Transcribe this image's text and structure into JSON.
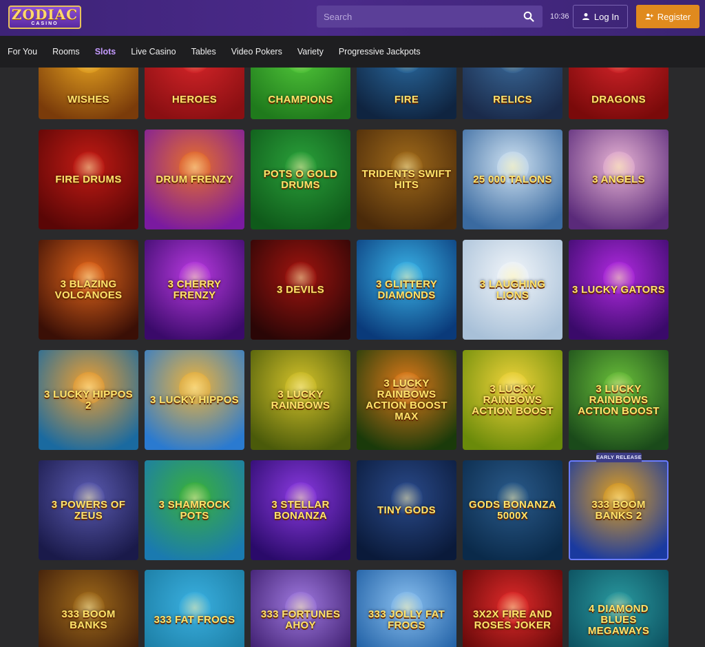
{
  "header": {
    "logo_text": "ZODIAC",
    "logo_sub": "CASINO",
    "search_placeholder": "Search",
    "time": "10:36",
    "login_label": "Log In",
    "register_label": "Register"
  },
  "nav": {
    "items": [
      {
        "label": "For You"
      },
      {
        "label": "Rooms"
      },
      {
        "label": "Slots",
        "active": true
      },
      {
        "label": "Live Casino"
      },
      {
        "label": "Tables"
      },
      {
        "label": "Video Pokers"
      },
      {
        "label": "Variety"
      },
      {
        "label": "Progressive Jackpots"
      }
    ]
  },
  "badge": "EARLY RELEASE",
  "games": [
    [
      {
        "title": "WISHES",
        "colors": [
          "#7a3b0a",
          "#e8a520"
        ]
      },
      {
        "title": "HEROES",
        "colors": [
          "#8a0f12",
          "#d8262a"
        ]
      },
      {
        "title": "CHAMPIONS",
        "colors": [
          "#1f7a1c",
          "#52c83a"
        ]
      },
      {
        "title": "FIRE",
        "colors": [
          "#0f2440",
          "#2a6aa0"
        ]
      },
      {
        "title": "Relics",
        "colors": [
          "#1a2a4a",
          "#3a6a9a"
        ]
      },
      {
        "title": "DRAGONS",
        "colors": [
          "#7a0a0a",
          "#d4242a"
        ]
      }
    ],
    [
      {
        "title": "FIRE DRUMS",
        "colors": [
          "#5a0606",
          "#c21b14"
        ]
      },
      {
        "title": "DRUM FRENZY",
        "colors": [
          "#7a1aa0",
          "#e8702a"
        ]
      },
      {
        "title": "POTS O GOLD DRUMS",
        "colors": [
          "#0f5a1a",
          "#2aa03a"
        ]
      },
      {
        "title": "TRIDENTS SWIFT HITS",
        "colors": [
          "#4a2a0a",
          "#a06a1a"
        ]
      },
      {
        "title": "25 000 TALONS",
        "colors": [
          "#3a6aa0",
          "#cfe2f2"
        ]
      },
      {
        "title": "3 ANGELS",
        "colors": [
          "#5a2a7a",
          "#e8b4d4"
        ]
      }
    ],
    [
      {
        "title": "3 BLAZING VOLCANOES",
        "colors": [
          "#3a0f06",
          "#e0641a"
        ]
      },
      {
        "title": "3 Cherry Frenzy",
        "colors": [
          "#3a0a6a",
          "#b83ae0"
        ]
      },
      {
        "title": "3 DEVILS",
        "colors": [
          "#2a0606",
          "#a0140f"
        ]
      },
      {
        "title": "3 GLITTERY DIAMONDS",
        "colors": [
          "#0a3a7a",
          "#3ab4e8"
        ]
      },
      {
        "title": "3 LAUGHING LIONS",
        "colors": [
          "#a8c0d8",
          "#f2f6fa"
        ]
      },
      {
        "title": "3 LUCKY GATORS",
        "colors": [
          "#3a0a6a",
          "#b02ae0"
        ]
      }
    ],
    [
      {
        "title": "3 LUCKY HIPPOS 2",
        "colors": [
          "#1a6aa0",
          "#f0a030"
        ]
      },
      {
        "title": "3 LUCKY HIPPOS",
        "colors": [
          "#2a7ad0",
          "#f0b43a"
        ]
      },
      {
        "title": "3 Lucky Rainbows",
        "colors": [
          "#4a5a0a",
          "#d4c22a"
        ]
      },
      {
        "title": "3 Lucky Rainbows ACTION BOOST MAX",
        "colors": [
          "#1a3a0a",
          "#e07a1a"
        ]
      },
      {
        "title": "3 LUCKY RAINBOWS ACTION BOOST",
        "colors": [
          "#6a8a0a",
          "#f0d43a"
        ]
      },
      {
        "title": "3 LUCKY RAINBOWS ACTION BOOST",
        "colors": [
          "#1a4a1a",
          "#6ac03a"
        ]
      }
    ],
    [
      {
        "title": "3 POWERS OF ZEUS",
        "colors": [
          "#1a1a4a",
          "#5a5ab0"
        ]
      },
      {
        "title": "3 SHAMROCK POTS",
        "colors": [
          "#1a7ab0",
          "#3ab03a"
        ]
      },
      {
        "title": "3 Stellar Bonanza",
        "colors": [
          "#2a0a6a",
          "#8a3ae0"
        ]
      },
      {
        "title": "TINY GODS",
        "colors": [
          "#0a1a3a",
          "#2a4a8a"
        ]
      },
      {
        "title": "GODS BONANZA 5000X",
        "colors": [
          "#0a2a4a",
          "#2a5a8a"
        ]
      },
      {
        "title": "333 BOOM BANKS 2",
        "colors": [
          "#1a3aa0",
          "#e0a020"
        ],
        "early": true
      }
    ],
    [
      {
        "title": "333 BOOM BANKS",
        "colors": [
          "#3a1a0a",
          "#a06a1a"
        ]
      },
      {
        "title": "333 FAT FROGS",
        "colors": [
          "#1a7aa0",
          "#3ab0e0"
        ]
      },
      {
        "title": "333 FORTUNES AHOY",
        "colors": [
          "#3a1a6a",
          "#a07ae0"
        ]
      },
      {
        "title": "333 JOLLY FAT FROGS",
        "colors": [
          "#1a5aa0",
          "#8ac0f0"
        ]
      },
      {
        "title": "3x2x FIRE AND ROSES JOKER",
        "colors": [
          "#5a0606",
          "#e02a2a"
        ]
      },
      {
        "title": "4 DIAMOND Blues MEGAWAYS",
        "colors": [
          "#0a4a5a",
          "#2a9aa0"
        ]
      }
    ]
  ]
}
